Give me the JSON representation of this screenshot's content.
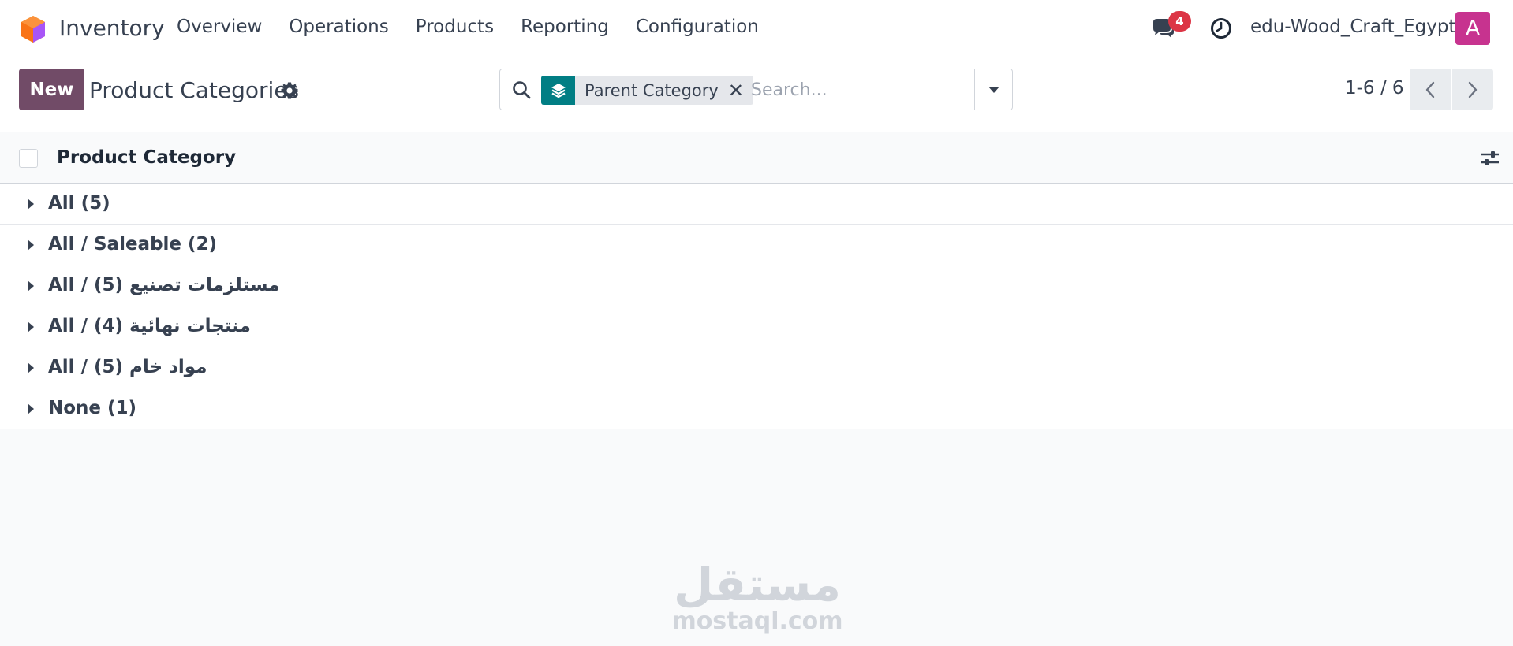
{
  "navbar": {
    "app_name": "Inventory",
    "menu": [
      "Overview",
      "Operations",
      "Products",
      "Reporting",
      "Configuration"
    ],
    "notification_count": "4",
    "company": "edu-Wood_Craft_Egypt",
    "avatar_letter": "A",
    "icons": [
      "app-logo-icon",
      "chat-icon",
      "clock-icon"
    ]
  },
  "control_panel": {
    "new_label": "New",
    "title": "Product Categories",
    "facet_label": "Parent Category",
    "facet_close": "✕",
    "search_placeholder": "Search...",
    "pager": "1-6 / 6"
  },
  "list": {
    "column_header": "Product Category",
    "groups": [
      "All (5)",
      "All / Saleable (2)",
      "All / مستلزمات تصنيع (5)",
      "All / منتجات نهائية (4)",
      "All / مواد خام (5)",
      "None (1)"
    ]
  },
  "watermark": {
    "arabic": "مستقل",
    "latin": "mostaql.com"
  },
  "colors": {
    "primary": "#714b67",
    "facet_teal": "#017e84",
    "badge_red": "#dc3545",
    "avatar_pink": "#c7338f"
  }
}
